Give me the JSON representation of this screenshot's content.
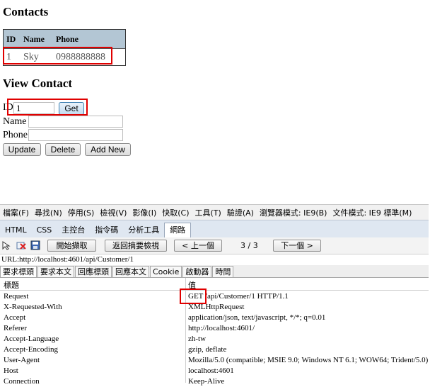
{
  "page": {
    "contacts_title": "Contacts",
    "table": {
      "headers": [
        "ID",
        "Name",
        "Phone"
      ],
      "rows": [
        [
          "1",
          "Sky",
          "0988888888"
        ]
      ]
    },
    "view_title": "View Contact",
    "id_label": "ID",
    "id_value": "1",
    "get_label": "Get",
    "name_label": "Name",
    "phone_label": "Phone",
    "update_label": "Update",
    "delete_label": "Delete",
    "addnew_label": "Add New"
  },
  "devtools": {
    "menu": [
      "檔案(F)",
      "尋找(N)",
      "停用(S)",
      "檢視(V)",
      "影像(I)",
      "快取(C)",
      "工具(T)",
      "驗證(A)",
      "瀏覽器模式: IE9(B)",
      "文件模式: IE9 標準(M)"
    ],
    "tabs": [
      "HTML",
      "CSS",
      "主控台",
      "指令碼",
      "分析工具",
      "網路"
    ],
    "active_tab": "網路",
    "toolbar": {
      "start_capture": "開始擷取",
      "back_summary": "返回摘要檢視",
      "prev": "< 上一個",
      "counter": "3 / 3",
      "next": "下一個 >"
    },
    "url_text": "URL:http://localhost:4601/api/Customer/1",
    "subtabs": [
      "要求標頭",
      "要求本文",
      "回應標頭",
      "回應本文",
      "Cookie",
      "啟動器",
      "時間"
    ],
    "active_subtab": "要求標頭",
    "col_key": "標題",
    "col_value": "值",
    "headers": [
      {
        "key": "Request",
        "value": "GET /api/Customer/1 HTTP/1.1"
      },
      {
        "key": "X-Requested-With",
        "value": "XMLHttpRequest"
      },
      {
        "key": "Accept",
        "value": "application/json, text/javascript, */*; q=0.01"
      },
      {
        "key": "Referer",
        "value": "http://localhost:4601/"
      },
      {
        "key": "Accept-Language",
        "value": "zh-tw"
      },
      {
        "key": "Accept-Encoding",
        "value": "gzip, deflate"
      },
      {
        "key": "User-Agent",
        "value": "Mozilla/5.0 (compatible; MSIE 9.0; Windows NT 6.1; WOW64; Trident/5.0)"
      },
      {
        "key": "Host",
        "value": "localhost:4601"
      },
      {
        "key": "Connection",
        "value": "Keep-Alive"
      }
    ],
    "highlight_color": "#e00000"
  }
}
